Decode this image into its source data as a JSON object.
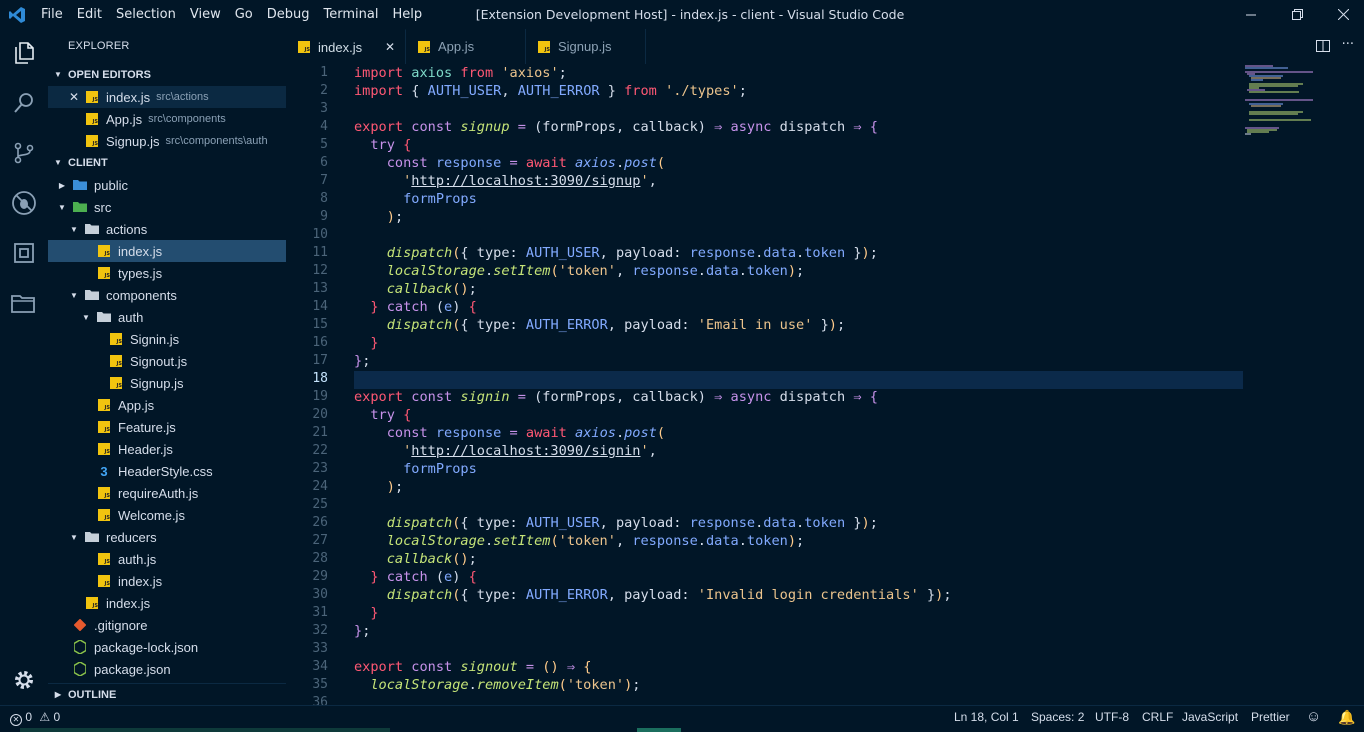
{
  "window": {
    "title": "[Extension Development Host] - index.js - client - Visual Studio Code",
    "menu": [
      "File",
      "Edit",
      "Selection",
      "View",
      "Go",
      "Debug",
      "Terminal",
      "Help"
    ]
  },
  "sidebar": {
    "header": "EXPLORER",
    "open_editors_label": "OPEN EDITORS",
    "open_editors": [
      {
        "name": "index.js",
        "desc": "src\\actions"
      },
      {
        "name": "App.js",
        "desc": "src\\components"
      },
      {
        "name": "Signup.js",
        "desc": "src\\components\\auth"
      }
    ],
    "project_label": "CLIENT",
    "tree": [
      {
        "name": "public",
        "type": "folder",
        "depth": 1
      },
      {
        "name": "src",
        "type": "folder",
        "depth": 1
      },
      {
        "name": "actions",
        "type": "folder",
        "depth": 2
      },
      {
        "name": "index.js",
        "type": "js",
        "depth": 3,
        "selected": true
      },
      {
        "name": "types.js",
        "type": "js",
        "depth": 3
      },
      {
        "name": "components",
        "type": "folder",
        "depth": 2
      },
      {
        "name": "auth",
        "type": "folder",
        "depth": 3
      },
      {
        "name": "Signin.js",
        "type": "js",
        "depth": 4
      },
      {
        "name": "Signout.js",
        "type": "js",
        "depth": 4
      },
      {
        "name": "Signup.js",
        "type": "js",
        "depth": 4
      },
      {
        "name": "App.js",
        "type": "js",
        "depth": 3
      },
      {
        "name": "Feature.js",
        "type": "js",
        "depth": 3
      },
      {
        "name": "Header.js",
        "type": "js",
        "depth": 3
      },
      {
        "name": "HeaderStyle.css",
        "type": "css",
        "depth": 3
      },
      {
        "name": "requireAuth.js",
        "type": "js",
        "depth": 3
      },
      {
        "name": "Welcome.js",
        "type": "js",
        "depth": 3
      },
      {
        "name": "reducers",
        "type": "folder",
        "depth": 2
      },
      {
        "name": "auth.js",
        "type": "js",
        "depth": 3
      },
      {
        "name": "index.js",
        "type": "js",
        "depth": 3
      },
      {
        "name": "index.js",
        "type": "js",
        "depth": 2
      },
      {
        "name": ".gitignore",
        "type": "git",
        "depth": 1
      },
      {
        "name": "package-lock.json",
        "type": "node",
        "depth": 1
      },
      {
        "name": "package.json",
        "type": "node",
        "depth": 1
      }
    ],
    "outline_label": "OUTLINE"
  },
  "tabs": [
    {
      "label": "index.js",
      "active": true
    },
    {
      "label": "App.js",
      "active": false
    },
    {
      "label": "Signup.js",
      "active": false
    }
  ],
  "editor": {
    "current_line": 18,
    "line_numbers": [
      "1",
      "2",
      "3",
      "4",
      "5",
      "6",
      "7",
      "8",
      "9",
      "10",
      "11",
      "12",
      "13",
      "14",
      "15",
      "16",
      "17",
      "18",
      "19",
      "20",
      "21",
      "22",
      "23",
      "24",
      "25",
      "26",
      "27",
      "28",
      "29",
      "30",
      "31",
      "32",
      "33",
      "34",
      "35",
      "36"
    ]
  },
  "statusbar": {
    "errors": "0",
    "warnings": "0",
    "position": "Ln 18, Col 1",
    "spaces": "Spaces: 2",
    "encoding": "UTF-8",
    "eol": "CRLF",
    "language": "JavaScript",
    "formatter": "Prettier"
  },
  "colors": {
    "background": "#011627",
    "selection": "#234d70",
    "keyword": "#c792ea",
    "string": "#ecc48d",
    "variable": "#7fdbca",
    "function": "#82aaff"
  }
}
